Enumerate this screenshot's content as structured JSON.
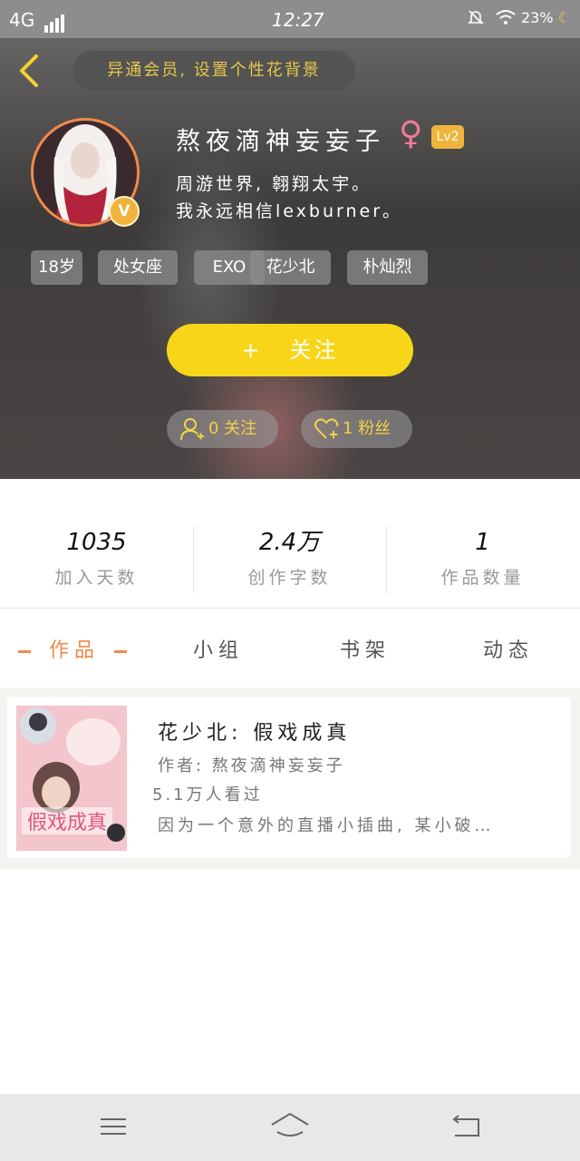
{
  "status_bar": {
    "network": "4G",
    "time": "12:27",
    "battery": "23%"
  },
  "header": {
    "custom_bg_label": "异通会员, 设置个性花背景"
  },
  "profile": {
    "username": "熬夜滴神妄妄子",
    "gender_symbol": "♀",
    "level": "Lv2",
    "vip_letter": "V",
    "bio_line1": "周游世界, 翱翔太宇。",
    "bio_line2": "我永远相信lexburner。"
  },
  "tags": [
    "18岁",
    "处女座",
    "EXO",
    "花少北",
    "朴灿烈"
  ],
  "follow_button": {
    "plus": "+",
    "label": "关注"
  },
  "social": {
    "following_label": "0 关注",
    "followers_label": "1 粉丝"
  },
  "stats": [
    {
      "value": "1035",
      "label": "加入天数"
    },
    {
      "value": "2.4万",
      "label": "创作字数"
    },
    {
      "value": "1",
      "label": "作品数量"
    }
  ],
  "tabs": [
    {
      "label": "作品",
      "active": true
    },
    {
      "label": "小组",
      "active": false
    },
    {
      "label": "书架",
      "active": false
    },
    {
      "label": "动态",
      "active": false
    }
  ],
  "works": [
    {
      "title": "花少北: 假戏成真",
      "author": "作者: 熬夜滴神妄妄子",
      "views": "5.1万人看过",
      "description": "因为一个意外的直播小插曲, 某小破…",
      "cover_text": "假戏成真"
    }
  ],
  "colors": {
    "accent_yellow": "#f7d61a",
    "accent_orange": "#f08a4a",
    "gold": "#f0b43c"
  }
}
